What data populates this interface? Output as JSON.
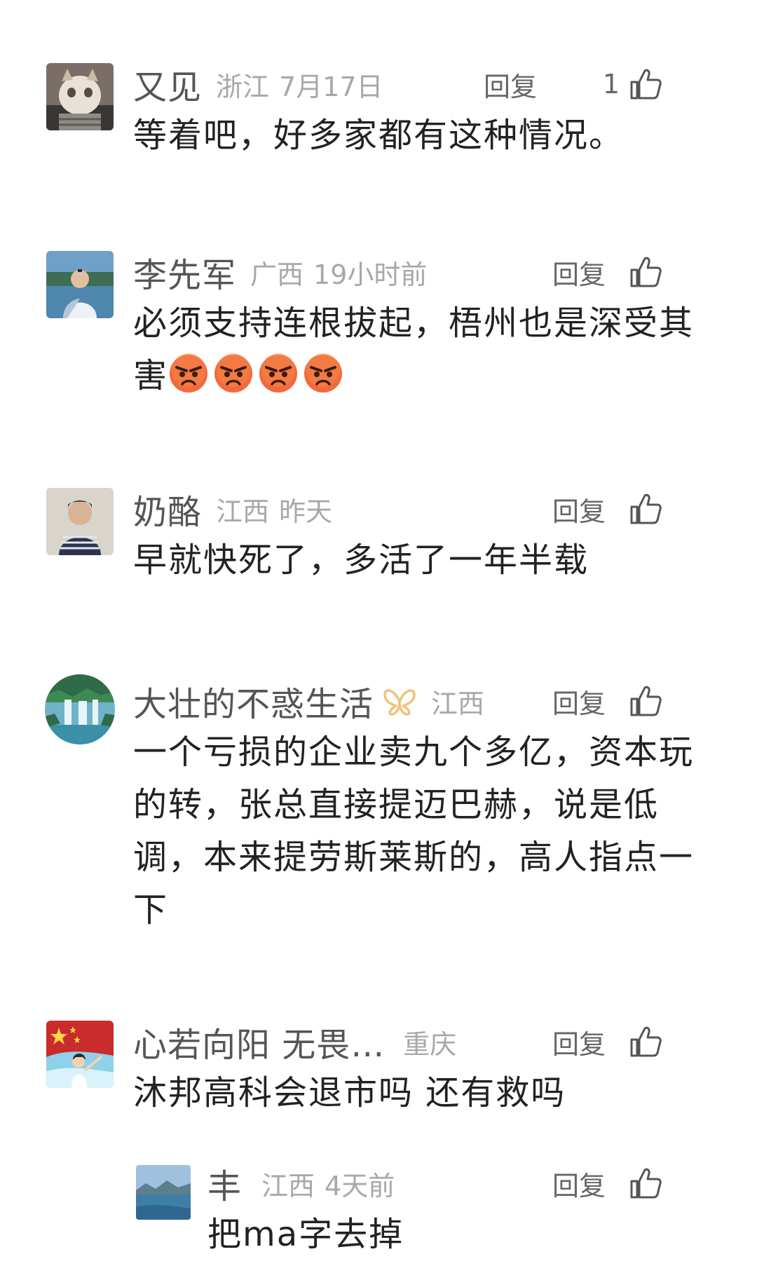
{
  "comments": [
    {
      "name": "又见",
      "location": "浙江",
      "time": "7月17日",
      "reply_label": "回复",
      "like_count": "1",
      "text": "等着吧，好多家都有这种情况。"
    },
    {
      "name": "李先军",
      "location": "广西",
      "time": "19小时前",
      "reply_label": "回复",
      "text": "必须支持连根拔起，梧州也是深受其害",
      "emoji": "angry-face"
    },
    {
      "name": "奶酪",
      "location": "江西",
      "time": "昨天",
      "reply_label": "回复",
      "text": "早就快死了，多活了一年半载"
    },
    {
      "name": "大壮的不惑生活",
      "badge": "vip-butterfly-icon",
      "location": "江西",
      "reply_label": "回复",
      "text": "一个亏损的企业卖九个多亿，资本玩的转，张总直接提迈巴赫，说是低调，本来提劳斯莱斯的，高人指点一下"
    },
    {
      "name": "心若向阳 无畏…",
      "location": "重庆",
      "reply_label": "回复",
      "text": "沐邦高科会退市吗 还有救吗",
      "replies": [
        {
          "name": "丰",
          "location": "江西",
          "time": "4天前",
          "reply_label": "回复",
          "text": "把ma字去掉"
        }
      ]
    }
  ],
  "colors": {
    "name": "#555555",
    "meta": "#a8a8a8",
    "text": "#222222",
    "badge": "#f2c27a"
  }
}
